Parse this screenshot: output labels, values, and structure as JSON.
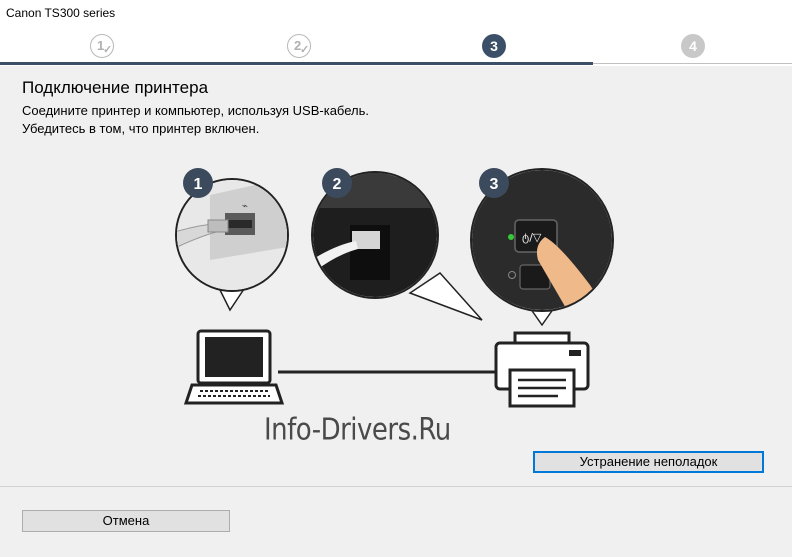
{
  "window": {
    "title": "Canon TS300 series"
  },
  "steps": [
    {
      "number": "1",
      "state": "done"
    },
    {
      "number": "2",
      "state": "done"
    },
    {
      "number": "3",
      "state": "current"
    },
    {
      "number": "4",
      "state": "future"
    }
  ],
  "content": {
    "heading": "Подключение принтера",
    "line1": "Соедините принтер и компьютер, используя USB-кабель.",
    "line2": "Убедитесь в том, что принтер включен."
  },
  "illustration": {
    "callouts": [
      "1",
      "2",
      "3"
    ],
    "power_label": "ტ/⊽",
    "power_led_color": "#37c837"
  },
  "watermark": "Info-Drivers.Ru",
  "buttons": {
    "troubleshoot": "Устранение неполадок",
    "cancel": "Отмена"
  },
  "colors": {
    "accent": "#3b5068",
    "inactive_step": "#c8c8c8"
  }
}
